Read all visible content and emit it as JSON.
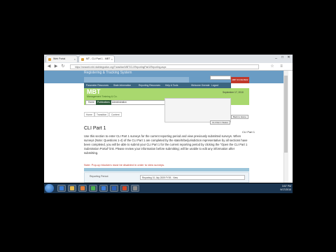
{
  "browser": {
    "tabs": [
      {
        "label": "Web Portal"
      },
      {
        "label": "MT - CLI Part 1 - MBT"
      }
    ],
    "url": "https://mrsweb.mbt.nistintegration.org/Transition/MBT/CLI/ReportingPart1/Reporting.aspx",
    "window_buttons": [
      "_",
      "□",
      "✕"
    ],
    "nav_icons": [
      "back-icon",
      "forward-icon",
      "reload-icon"
    ]
  },
  "site": {
    "system_title": "Registering & Tracking System",
    "nav": [
      "Parameter Resources",
      "State Information",
      "Reporting Resources",
      "Help & Tools",
      "Welcome Gnerate",
      "Logout"
    ],
    "red_button": "MBT IN REVIEW",
    "brand": "MBT",
    "brand_subtitle": "Management Training & Co.",
    "green_tabs": [
      "Home",
      "Publications",
      "Administration"
    ],
    "date": "September 17, 2010",
    "breadcrumbs": [
      "Home",
      "Transition",
      "Content"
    ],
    "side_buttons": [
      "Back to Home",
      "CLI Part 1 Status"
    ]
  },
  "content": {
    "heading": "CLI Part 1",
    "right_label": "CLI Part 1",
    "paragraph": "Use this section to enter CLI Part 1 surveys for the current reporting period and view previously submitted surveys. When surveys (Note: Questions 1-4) of the CLI Part 1 are completed by the state/tribe/jurisdiction representative by all sections have been completed, you will be able to submit your CLI Part 1 for the current reporting period by clicking the \"Open the CLI Part 1 Submission Portal\" link. Please review your information before submitting; will be unable to edit any information after submitting.",
    "note": "Note: Pop-up blockers must be disabled in order to view surveys.",
    "table_label": "Reporting Period:",
    "table_select": "Reporting 01 July 2009 FY09 - View"
  },
  "taskbar": {
    "icons": [
      "start-orb-icon",
      "ie-icon",
      "folder-icon",
      "media-icon",
      "chrome-icon",
      "explorer-icon",
      "word-icon",
      "powerpoint-icon",
      "app-icon"
    ],
    "icon_colors": [
      "#1e5aa8",
      "#3a7bd5",
      "#e6b84a",
      "#e07b39",
      "#4caf50",
      "#3d7dd8",
      "#2b5eb5",
      "#d24726",
      "#8a8a8a"
    ],
    "time": "3:57 PM",
    "date": "9/17/2010"
  }
}
